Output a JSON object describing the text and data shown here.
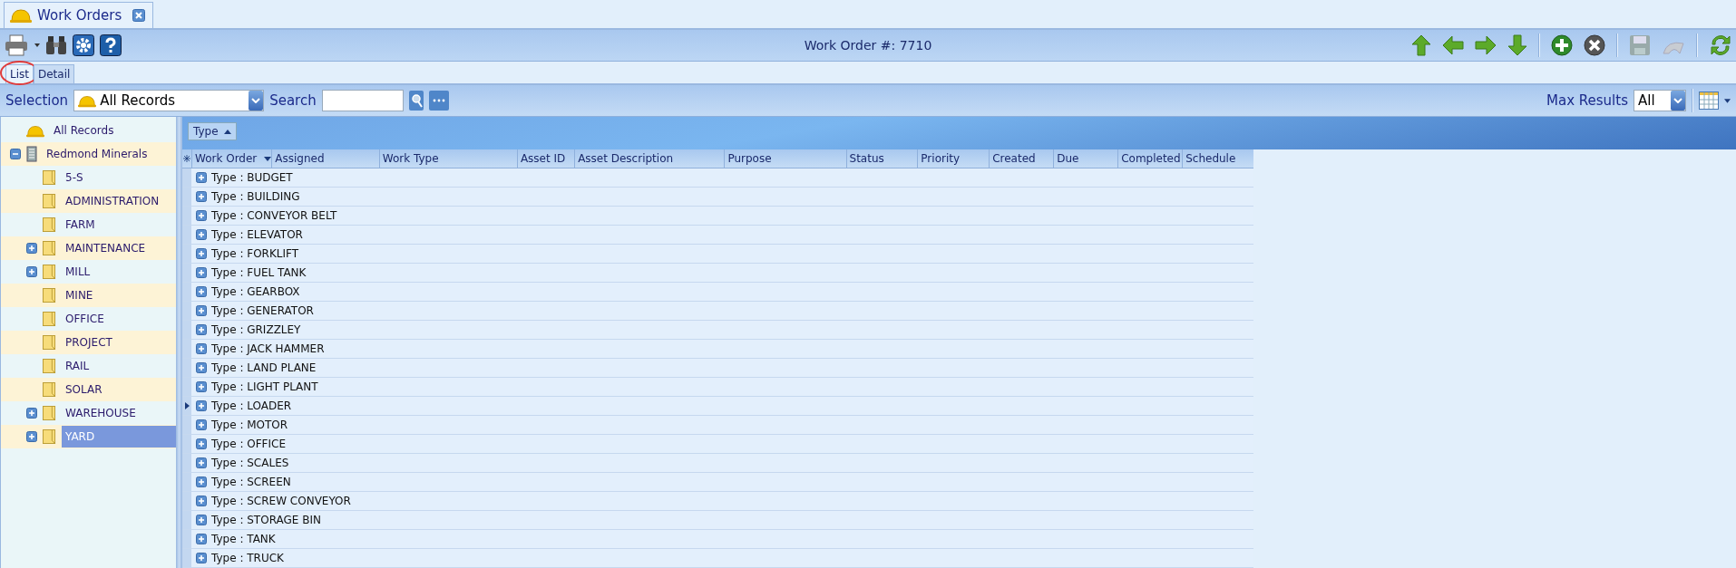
{
  "document_tab": {
    "title": "Work Orders"
  },
  "toolbar": {
    "title": "Work Order #: 7710"
  },
  "view_tabs": [
    {
      "label": "List",
      "selected": true,
      "highlighted": true
    },
    {
      "label": "Detail",
      "selected": false,
      "highlighted": false
    }
  ],
  "selection": {
    "label": "Selection",
    "value": "All Records"
  },
  "search": {
    "label": "Search"
  },
  "max_results": {
    "label": "Max Results",
    "value": "All"
  },
  "tree": [
    {
      "label": "All Records",
      "kind": "root",
      "selected": false
    },
    {
      "label": "Redmond Minerals",
      "kind": "company",
      "selected": false,
      "expanded": true,
      "children": [
        {
          "label": "5-S",
          "kind": "folder",
          "selected": false
        },
        {
          "label": "ADMINISTRATION",
          "kind": "folder",
          "selected": false
        },
        {
          "label": "FARM",
          "kind": "folder",
          "selected": false
        },
        {
          "label": "MAINTENANCE",
          "kind": "folder",
          "selected": false,
          "expanded": false
        },
        {
          "label": "MILL",
          "kind": "folder",
          "selected": false,
          "expanded": false
        },
        {
          "label": "MINE",
          "kind": "folder",
          "selected": false
        },
        {
          "label": "OFFICE",
          "kind": "folder",
          "selected": false
        },
        {
          "label": "PROJECT",
          "kind": "folder",
          "selected": false
        },
        {
          "label": "RAIL",
          "kind": "folder",
          "selected": false
        },
        {
          "label": "SOLAR",
          "kind": "folder",
          "selected": false
        },
        {
          "label": "WAREHOUSE",
          "kind": "folder",
          "selected": false,
          "expanded": false
        },
        {
          "label": "YARD",
          "kind": "folder",
          "selected": true,
          "expanded": false
        }
      ]
    }
  ],
  "group_by": {
    "label": "Type",
    "sort_ascending": true
  },
  "table": {
    "columns": [
      {
        "label": "Work Order",
        "sort_descending": true
      },
      {
        "label": "Assigned",
        "sort_descending": false
      },
      {
        "label": "Work Type",
        "sort_descending": false
      },
      {
        "label": "Asset ID",
        "sort_descending": false
      },
      {
        "label": "Asset Description",
        "sort_descending": false
      },
      {
        "label": "Purpose",
        "sort_descending": false
      },
      {
        "label": "Status",
        "sort_descending": false
      },
      {
        "label": "Priority",
        "sort_descending": false
      },
      {
        "label": "Created",
        "sort_descending": false
      },
      {
        "label": "Due",
        "sort_descending": false
      },
      {
        "label": "Completed",
        "sort_descending": false
      },
      {
        "label": "Schedule",
        "sort_descending": false
      }
    ],
    "rows": [
      {
        "group": "Type : BUDGET",
        "current": false,
        "expanded": false
      },
      {
        "group": "Type : BUILDING",
        "current": false,
        "expanded": false
      },
      {
        "group": "Type : CONVEYOR BELT",
        "current": false,
        "expanded": false
      },
      {
        "group": "Type : ELEVATOR",
        "current": false,
        "expanded": false
      },
      {
        "group": "Type : FORKLIFT",
        "current": false,
        "expanded": false
      },
      {
        "group": "Type : FUEL TANK",
        "current": false,
        "expanded": false
      },
      {
        "group": "Type : GEARBOX",
        "current": false,
        "expanded": false
      },
      {
        "group": "Type : GENERATOR",
        "current": false,
        "expanded": false
      },
      {
        "group": "Type : GRIZZLEY",
        "current": false,
        "expanded": false
      },
      {
        "group": "Type : JACK HAMMER",
        "current": false,
        "expanded": false
      },
      {
        "group": "Type : LAND PLANE",
        "current": false,
        "expanded": false
      },
      {
        "group": "Type : LIGHT PLANT",
        "current": false,
        "expanded": false
      },
      {
        "group": "Type : LOADER",
        "current": true,
        "expanded": false
      },
      {
        "group": "Type : MOTOR",
        "current": false,
        "expanded": false
      },
      {
        "group": "Type : OFFICE",
        "current": false,
        "expanded": false
      },
      {
        "group": "Type : SCALES",
        "current": false,
        "expanded": false
      },
      {
        "group": "Type : SCREEN",
        "current": false,
        "expanded": false
      },
      {
        "group": "Type : SCREW CONVEYOR",
        "current": false,
        "expanded": false
      },
      {
        "group": "Type : STORAGE BIN",
        "current": false,
        "expanded": false
      },
      {
        "group": "Type : TANK",
        "current": false,
        "expanded": false
      },
      {
        "group": "Type : TRUCK",
        "current": false,
        "expanded": false
      }
    ]
  }
}
